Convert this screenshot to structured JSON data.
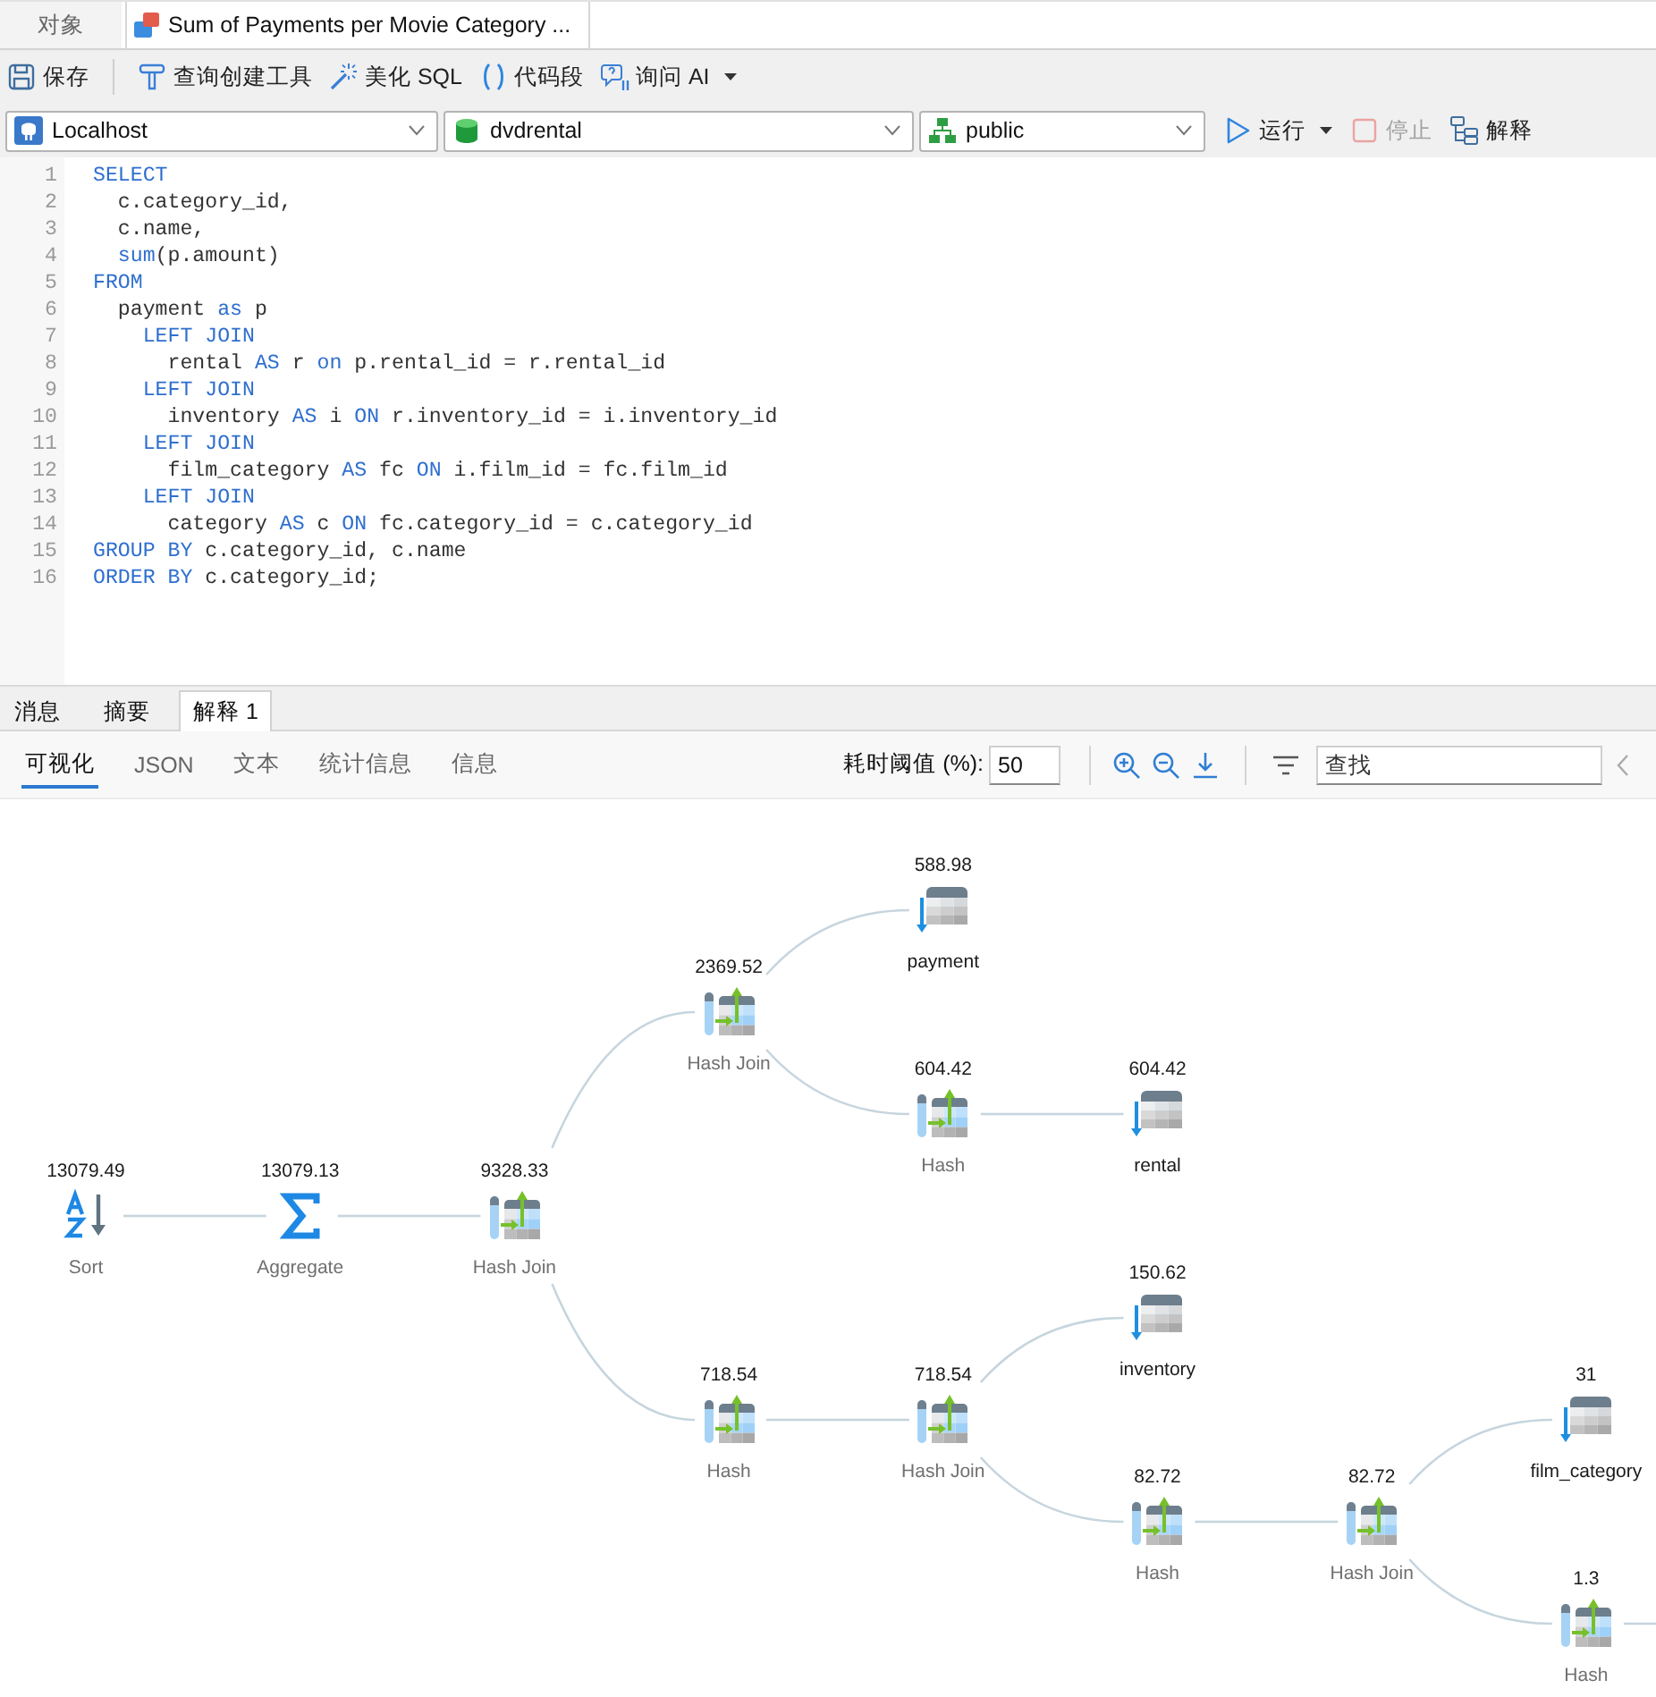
{
  "document_tabs": [
    {
      "kind": "objects",
      "label": "对象",
      "selected": false
    },
    {
      "kind": "query",
      "label": "Sum of Payments per Movie Category ...",
      "selected": true
    }
  ],
  "toolbar": {
    "groups": [
      [
        {
          "kind": "save",
          "label": "保存",
          "dropdown": false
        }
      ],
      [
        {
          "kind": "query_builder",
          "label": "查询创建工具",
          "dropdown": false
        },
        {
          "kind": "beautify",
          "label": "美化 SQL",
          "dropdown": false
        },
        {
          "kind": "snippet",
          "label": "代码段",
          "dropdown": false
        },
        {
          "kind": "ask_ai",
          "label": "询问 AI",
          "dropdown": true
        }
      ]
    ]
  },
  "connection_bar": {
    "selectors": [
      {
        "kind": "connection",
        "value": "Localhost"
      },
      {
        "kind": "database",
        "value": "dvdrental"
      },
      {
        "kind": "schema",
        "value": "public"
      }
    ],
    "actions": [
      {
        "kind": "run",
        "label": "运行",
        "dropdown": true,
        "disabled": false
      },
      {
        "kind": "stop",
        "label": "停止",
        "dropdown": false,
        "disabled": true
      },
      {
        "kind": "explain",
        "label": "解释",
        "dropdown": false,
        "disabled": false
      }
    ]
  },
  "editor": {
    "lines": [
      {
        "number": "1",
        "tokens": [
          {
            "text": "SELECT",
            "kind": "keyword"
          }
        ]
      },
      {
        "number": "2",
        "tokens": [
          {
            "text": "  c.category_id,",
            "kind": "plain"
          }
        ]
      },
      {
        "number": "3",
        "tokens": [
          {
            "text": "  c.name,",
            "kind": "plain"
          }
        ]
      },
      {
        "number": "4",
        "tokens": [
          {
            "text": "  sum",
            "kind": "keyword"
          },
          {
            "text": "(p.amount)",
            "kind": "plain"
          }
        ]
      },
      {
        "number": "5",
        "tokens": [
          {
            "text": "FROM",
            "kind": "keyword"
          }
        ]
      },
      {
        "number": "6",
        "tokens": [
          {
            "text": "  payment ",
            "kind": "plain"
          },
          {
            "text": "as",
            "kind": "keyword"
          },
          {
            "text": " p",
            "kind": "plain"
          }
        ]
      },
      {
        "number": "7",
        "tokens": [
          {
            "text": "    LEFT JOIN",
            "kind": "keyword"
          }
        ]
      },
      {
        "number": "8",
        "tokens": [
          {
            "text": "      rental ",
            "kind": "plain"
          },
          {
            "text": "AS",
            "kind": "keyword"
          },
          {
            "text": " r ",
            "kind": "plain"
          },
          {
            "text": "on",
            "kind": "keyword"
          },
          {
            "text": " p.rental_id = r.rental_id",
            "kind": "plain"
          }
        ]
      },
      {
        "number": "9",
        "tokens": [
          {
            "text": "    LEFT JOIN",
            "kind": "keyword"
          }
        ]
      },
      {
        "number": "10",
        "tokens": [
          {
            "text": "      inventory ",
            "kind": "plain"
          },
          {
            "text": "AS",
            "kind": "keyword"
          },
          {
            "text": " i ",
            "kind": "plain"
          },
          {
            "text": "ON",
            "kind": "keyword"
          },
          {
            "text": " r.inventory_id = i.inventory_id",
            "kind": "plain"
          }
        ]
      },
      {
        "number": "11",
        "tokens": [
          {
            "text": "    LEFT JOIN",
            "kind": "keyword"
          }
        ]
      },
      {
        "number": "12",
        "tokens": [
          {
            "text": "      film_category ",
            "kind": "plain"
          },
          {
            "text": "AS",
            "kind": "keyword"
          },
          {
            "text": " fc ",
            "kind": "plain"
          },
          {
            "text": "ON",
            "kind": "keyword"
          },
          {
            "text": " i.film_id = fc.film_id",
            "kind": "plain"
          }
        ]
      },
      {
        "number": "13",
        "tokens": [
          {
            "text": "    LEFT JOIN",
            "kind": "keyword"
          }
        ]
      },
      {
        "number": "14",
        "tokens": [
          {
            "text": "      category ",
            "kind": "plain"
          },
          {
            "text": "AS",
            "kind": "keyword"
          },
          {
            "text": " c ",
            "kind": "plain"
          },
          {
            "text": "ON",
            "kind": "keyword"
          },
          {
            "text": " fc.category_id = c.category_id",
            "kind": "plain"
          }
        ]
      },
      {
        "number": "15",
        "tokens": [
          {
            "text": "GROUP BY",
            "kind": "keyword"
          },
          {
            "text": " c.category_id, c.name",
            "kind": "plain"
          }
        ]
      },
      {
        "number": "16",
        "tokens": [
          {
            "text": "ORDER BY",
            "kind": "keyword"
          },
          {
            "text": " c.category_id;",
            "kind": "plain"
          }
        ]
      }
    ]
  },
  "result_tabs": [
    {
      "label": "消息",
      "selected": false
    },
    {
      "label": "摘要",
      "selected": false
    },
    {
      "label": "解释 1",
      "selected": true
    }
  ],
  "plan_view": {
    "tabs": [
      {
        "label": "可视化",
        "selected": true
      },
      {
        "label": "JSON",
        "selected": false
      },
      {
        "label": "文本",
        "selected": false
      },
      {
        "label": "统计信息",
        "selected": false
      },
      {
        "label": "信息",
        "selected": false
      }
    ],
    "threshold": {
      "label": "耗时阈值 (%):",
      "value": "50"
    },
    "search": {
      "placeholder": "查找"
    },
    "plan": {
      "kind": "sort",
      "label": "Sort",
      "cost": "13079.49",
      "offscreen_child": false,
      "children": [
        {
          "kind": "aggregate",
          "label": "Aggregate",
          "cost": "13079.13",
          "offscreen_child": false,
          "children": [
            {
              "kind": "hash",
              "label": "Hash Join",
              "cost": "9328.33",
              "offscreen_child": false,
              "children": [
                {
                  "kind": "hash",
                  "label": "Hash Join",
                  "cost": "2369.52",
                  "offscreen_child": false,
                  "children": [
                    {
                      "kind": "table",
                      "label": "payment",
                      "cost": "588.98",
                      "offscreen_child": false
                    },
                    {
                      "kind": "hash",
                      "label": "Hash",
                      "cost": "604.42",
                      "offscreen_child": false,
                      "children": [
                        {
                          "kind": "table",
                          "label": "rental",
                          "cost": "604.42",
                          "offscreen_child": false
                        }
                      ]
                    }
                  ]
                },
                {
                  "kind": "hash",
                  "label": "Hash",
                  "cost": "718.54",
                  "offscreen_child": false,
                  "children": [
                    {
                      "kind": "hash",
                      "label": "Hash Join",
                      "cost": "718.54",
                      "offscreen_child": false,
                      "children": [
                        {
                          "kind": "table",
                          "label": "inventory",
                          "cost": "150.62",
                          "offscreen_child": false
                        },
                        {
                          "kind": "hash",
                          "label": "Hash",
                          "cost": "82.72",
                          "offscreen_child": false,
                          "children": [
                            {
                              "kind": "hash",
                              "label": "Hash Join",
                              "cost": "82.72",
                              "offscreen_child": false,
                              "children": [
                                {
                                  "kind": "table",
                                  "label": "film_category",
                                  "cost": "31",
                                  "offscreen_child": false
                                },
                                {
                                  "kind": "hash",
                                  "label": "Hash",
                                  "cost": "1.3",
                                  "offscreen_child": true
                                }
                              ]
                            }
                          ]
                        }
                      ]
                    }
                  ]
                }
              ]
            }
          ]
        }
      ]
    }
  }
}
